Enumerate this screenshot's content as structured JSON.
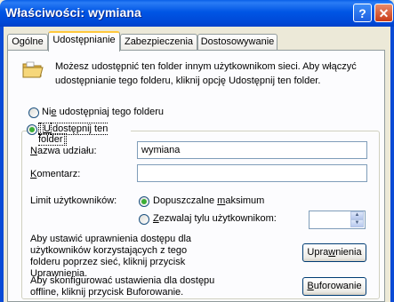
{
  "window": {
    "title": "Właściwości: wymiana"
  },
  "title_buttons": {
    "help": "?",
    "close": "✕"
  },
  "tabs": [
    {
      "label": "Ogólne",
      "active": false
    },
    {
      "label": "Udostępnianie",
      "active": true
    },
    {
      "label": "Zabezpieczenia",
      "active": false
    },
    {
      "label": "Dostosowywanie",
      "active": false
    }
  ],
  "info": {
    "icon": "folder-share-icon",
    "text": "Możesz udostępnić ten folder innym użytkownikom sieci. Aby włączyć udostępnianie tego folderu, kliknij opcję Udostępnij ten folder."
  },
  "sharing": {
    "option_no_share": {
      "pre": "Ni",
      "acc": "e",
      "post": " udostępniaj tego folderu",
      "selected": false
    },
    "option_share": {
      "pre": "",
      "acc": "U",
      "post": "dostępnij ten folder",
      "selected": true
    }
  },
  "fields": {
    "share_name_label": {
      "pre": "",
      "acc": "N",
      "post": "azwa udziału:"
    },
    "share_name_value": "wymiana",
    "comment_label": {
      "pre": "",
      "acc": "K",
      "post": "omentarz:"
    },
    "comment_value": ""
  },
  "user_limit": {
    "label": "Limit użytkowników:",
    "max_allowed": {
      "pre": "Dopuszczalne ",
      "acc": "m",
      "post": "aksimum",
      "selected": true
    },
    "allow_n": {
      "pre": "",
      "acc": "Z",
      "post": "ezwalaj tylu użytkownikom:",
      "selected": false
    },
    "spin_value": ""
  },
  "permissions": {
    "text": "Aby ustawić uprawnienia dostępu dla użytkowników korzystających z tego folderu poprzez sieć, kliknij przycisk Uprawnienia.",
    "button": {
      "pre": "Upra",
      "acc": "w",
      "post": "nienia"
    }
  },
  "caching": {
    "text": "Aby skonfigurować ustawienia dla dostępu offline, kliknij przycisk Buforowanie.",
    "button": {
      "pre": "",
      "acc": "B",
      "post": "uforowanie"
    }
  },
  "colors": {
    "titlebar": "#0055E5",
    "face": "#ECE9D8",
    "tab_highlight": "#FFC83C",
    "radio_dot": "#3BAE36"
  }
}
